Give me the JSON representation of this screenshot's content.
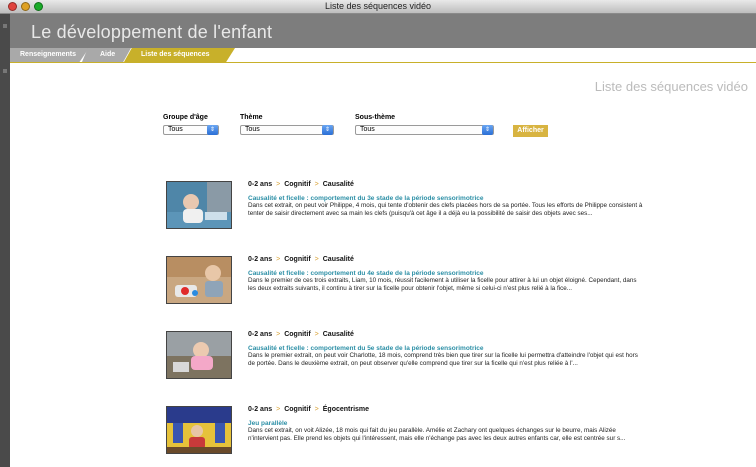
{
  "window": {
    "title": "Liste des séquences vidéo"
  },
  "app": {
    "title": "Le développement de l'enfant"
  },
  "tabs": [
    {
      "label": "Renseignements"
    },
    {
      "label": "Aide"
    },
    {
      "label": "Liste des séquences vidéo"
    }
  ],
  "page": {
    "heading": "Liste des séquences vidéo"
  },
  "filters": {
    "age": {
      "label": "Groupe d'âge",
      "value": "Tous"
    },
    "theme": {
      "label": "Thème",
      "value": "Tous"
    },
    "subtheme": {
      "label": "Sous-thème",
      "value": "Tous"
    },
    "submit_label": "Afficher"
  },
  "items": [
    {
      "age": "0-2 ans",
      "theme": "Cognitif",
      "subtheme": "Causalité",
      "title": "Causalité et ficelle : comportement du 3e stade de la période sensorimotrice",
      "desc": "Dans cet extrait, on peut voir Philippe, 4 mois, qui tente d'obtenir des clefs placées hors de sa portée. Tous les efforts de Philippe consistent à tenter de saisir directement avec sa main les clefs (puisqu'à cet âge il a déjà eu la possibilité de saisir des objets avec ses..."
    },
    {
      "age": "0-2 ans",
      "theme": "Cognitif",
      "subtheme": "Causalité",
      "title": "Causalité et ficelle : comportement du 4e stade de la période sensorimotrice",
      "desc": "Dans le premier de ces trois extraits, Liam, 10 mois, réussit facilement à utiliser la ficelle pour attirer à lui un objet éloigné. Cependant, dans les deux extraits suivants, il continu à tirer sur la ficelle pour obtenir l'objet, même si celui-ci n'est plus relié à la fice..."
    },
    {
      "age": "0-2 ans",
      "theme": "Cognitif",
      "subtheme": "Causalité",
      "title": "Causalité et ficelle : comportement du 5e stade de la période sensorimotrice",
      "desc": "Dans le premier extrait, on peut voir Charlotte, 18 mois, comprend très bien que tirer sur la ficelle lui permettra d'atteindre l'objet qui est hors de portée. Dans le deuxième extrait, on peut observer qu'elle comprend que tirer sur la ficelle qui n'est plus reliée à l'..."
    },
    {
      "age": "0-2 ans",
      "theme": "Cognitif",
      "subtheme": "Égocentrisme",
      "title": "Jeu parallèle",
      "desc": "Dans cet extrait, on voit Alizée, 18 mois qui fait du jeu parallèle. Amélie et Zachary ont quelques échanges sur le beurre, mais Alizée n'intervient pas. Elle prend les objets qui l'intéressent, mais elle n'échange pas avec les deux autres enfants car, elle est centrée sur s..."
    }
  ]
}
